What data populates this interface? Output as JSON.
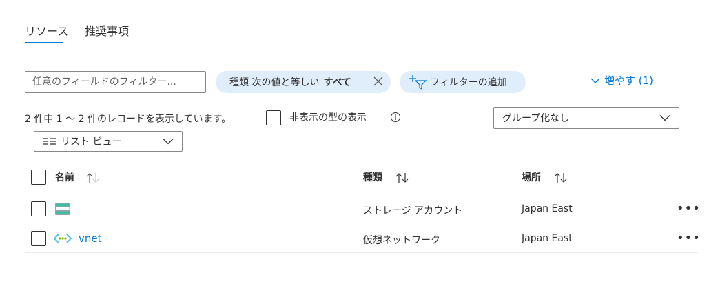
{
  "tabs": [
    {
      "label": "リソース",
      "active": true
    },
    {
      "label": "推奨事項",
      "active": false
    }
  ],
  "filter": {
    "placeholder": "任意のフィールドのフィルター...",
    "value": ""
  },
  "type_filter_pill": {
    "prefix": "種類 次の値と等しい",
    "value": "すべて"
  },
  "add_filter_label": "フィルターの追加",
  "more_link": "増やす (1)",
  "record_count": "2 件中 1 ～ 2 件のレコードを表示しています。",
  "show_hidden_label": "非表示の型の表示",
  "group_by": {
    "selected": "グループ化なし"
  },
  "view_mode": {
    "selected": "リスト ビュー"
  },
  "table": {
    "headers": {
      "name": "名前",
      "type": "種類",
      "location": "場所"
    },
    "rows": [
      {
        "name": "",
        "icon": "storage-account-icon",
        "type": "ストレージ アカウント",
        "location": "Japan East"
      },
      {
        "name": "vnet",
        "icon": "virtual-network-icon",
        "type": "仮想ネットワーク",
        "location": "Japan East"
      }
    ]
  },
  "colors": {
    "accent": "#0078d4",
    "pill_bg": "#e0eefb",
    "storage_green": "#3ebea5"
  }
}
